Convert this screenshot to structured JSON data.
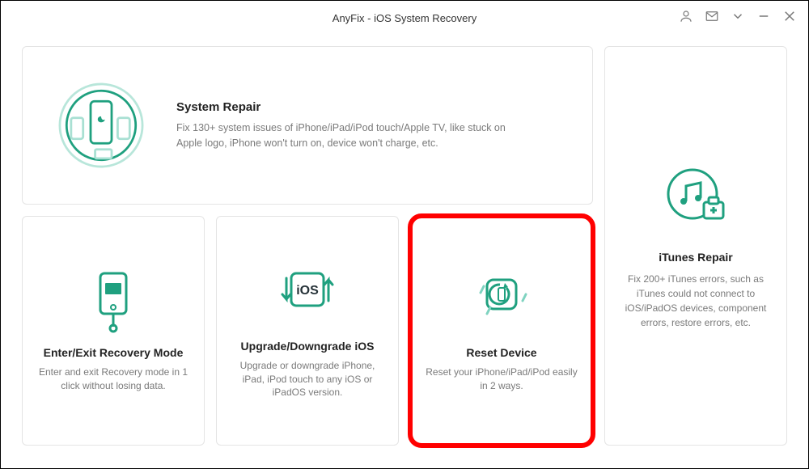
{
  "window": {
    "title": "AnyFix - iOS System Recovery"
  },
  "hero": {
    "title": "System Repair",
    "desc": "Fix 130+ system issues of iPhone/iPad/iPod touch/Apple TV, like stuck on Apple logo, iPhone won't turn on, device won't charge, etc."
  },
  "cards": {
    "recovery": {
      "title": "Enter/Exit Recovery Mode",
      "desc": "Enter and exit Recovery mode in 1 click without losing data."
    },
    "updown": {
      "title": "Upgrade/Downgrade iOS",
      "desc": "Upgrade or downgrade iPhone, iPad, iPod touch to any iOS or iPadOS version."
    },
    "reset": {
      "title": "Reset Device",
      "desc": "Reset your iPhone/iPad/iPod easily in 2 ways."
    }
  },
  "side": {
    "title": "iTunes Repair",
    "desc": "Fix 200+ iTunes errors, such as iTunes could not connect to iOS/iPadOS devices, component errors, restore errors, etc."
  },
  "colors": {
    "accent": "#1fa07f",
    "light": "#8fd9c7"
  }
}
